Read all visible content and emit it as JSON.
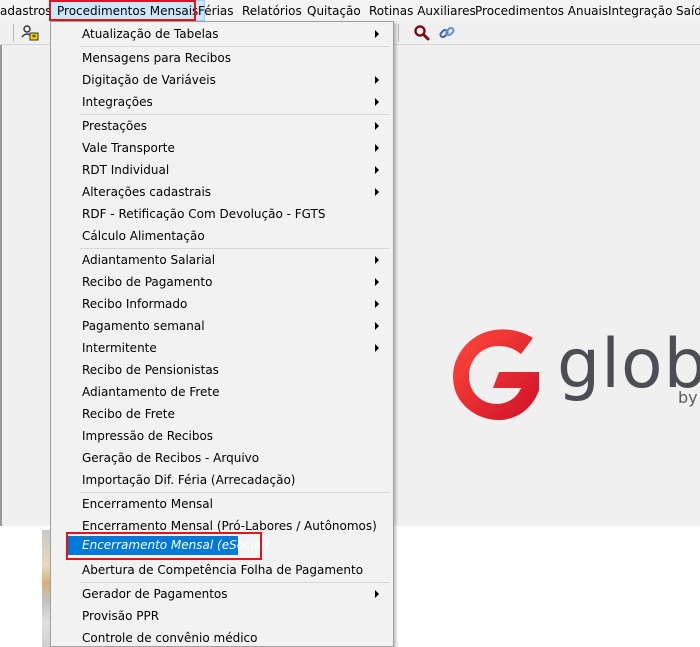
{
  "menubar": {
    "items": [
      "adastros",
      "Procedimentos Mensais",
      "Férias",
      "Relatórios",
      "Quitação",
      "Rotinas Auxiliares",
      "Procedimentos Anuais",
      "Integração",
      "Saíd"
    ]
  },
  "logo": {
    "text": "glob",
    "sub": "by",
    "accent_color": "#e41d2d"
  },
  "dropdown": {
    "items": [
      {
        "label": "Atualização de Tabelas",
        "submenu": true
      },
      {
        "label": "Mensagens para Recibos",
        "submenu": false
      },
      {
        "label": "Digitação de Variáveis",
        "submenu": true
      },
      {
        "label": "Integrações",
        "submenu": true
      },
      {
        "label": "Prestações",
        "submenu": true
      },
      {
        "label": "Vale Transporte",
        "submenu": true
      },
      {
        "label": "RDT Individual",
        "submenu": true
      },
      {
        "label": "Alterações cadastrais",
        "submenu": true
      },
      {
        "label": "RDF - Retificação Com Devolução - FGTS",
        "submenu": false
      },
      {
        "label": "Cálculo Alimentação",
        "submenu": false
      },
      {
        "label": "Adiantamento Salarial",
        "submenu": true
      },
      {
        "label": "Recibo de Pagamento",
        "submenu": true
      },
      {
        "label": "Recibo Informado",
        "submenu": true
      },
      {
        "label": "Pagamento semanal",
        "submenu": true
      },
      {
        "label": "Intermitente",
        "submenu": true
      },
      {
        "label": "Recibo de Pensionistas",
        "submenu": false
      },
      {
        "label": "Adiantamento de Frete",
        "submenu": false
      },
      {
        "label": "Recibo de Frete",
        "submenu": false
      },
      {
        "label": "Impressão de Recibos",
        "submenu": false
      },
      {
        "label": "Geração de Recibos - Arquivo",
        "submenu": false
      },
      {
        "label": "Importação Dif. Féria (Arrecadação)",
        "submenu": false
      },
      {
        "label": "Encerramento Mensal",
        "submenu": false
      },
      {
        "label": "Encerramento Mensal (Pró-Labores / Autônomos)",
        "submenu": false
      },
      {
        "label": "Encerramento Mensal (eSocial)",
        "submenu": false,
        "selected": true
      },
      {
        "label": "Abertura de Competência Folha de Pagamento",
        "submenu": false
      },
      {
        "label": "Gerador de Pagamentos",
        "submenu": true
      },
      {
        "label": "Provisão PPR",
        "submenu": false
      },
      {
        "label": "Controle de convênio médico",
        "submenu": false
      }
    ]
  },
  "colors": {
    "highlight_box": "#e0141e",
    "selection": "#0078d7",
    "menu_bg": "#f2f2f2"
  }
}
